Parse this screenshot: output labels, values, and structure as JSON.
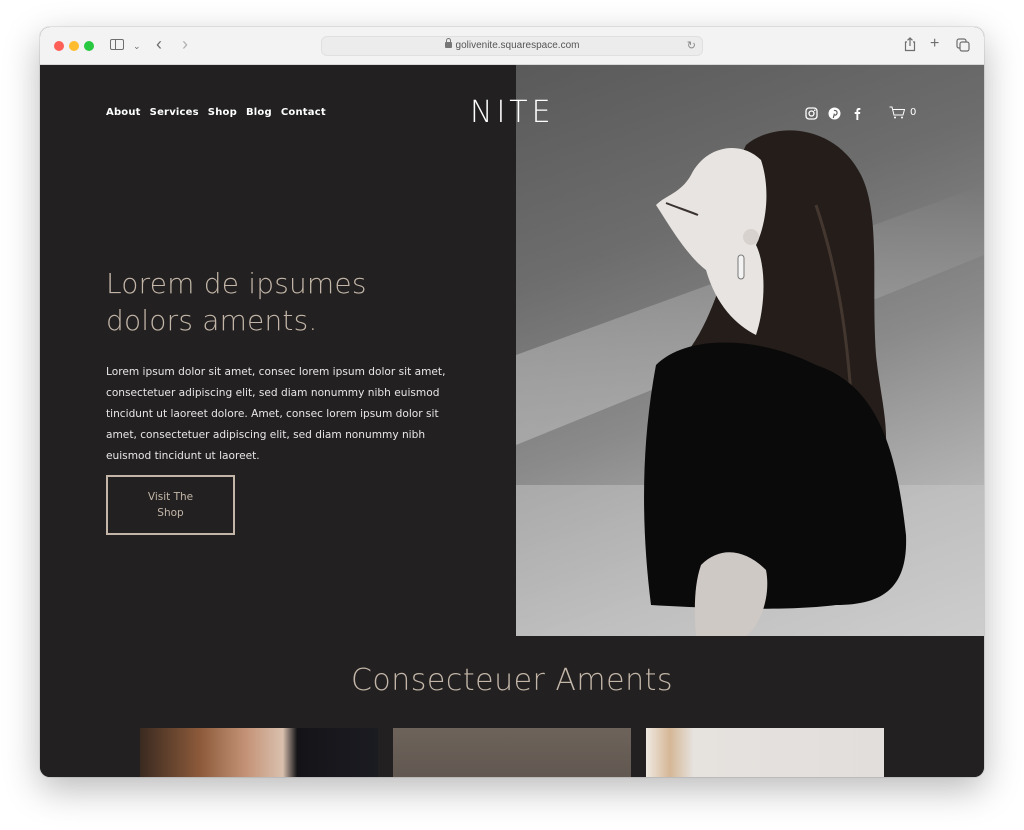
{
  "browser": {
    "url": "golivenite.squarespace.com",
    "buttons": {
      "sidebar": "sidebar-icon",
      "back": "‹",
      "forward": "›",
      "share": "share-icon",
      "new_tab": "+",
      "tabs": "tabs-icon",
      "reload": "↻"
    }
  },
  "site": {
    "logo": "NITE",
    "nav": [
      {
        "label": "About"
      },
      {
        "label": "Services"
      },
      {
        "label": "Shop"
      },
      {
        "label": "Blog"
      },
      {
        "label": "Contact"
      }
    ],
    "socials": [
      "instagram",
      "pinterest",
      "facebook"
    ],
    "cart_count": "0",
    "colors": {
      "background": "#222021",
      "accent": "#c3b6a8",
      "text": "#ffffff"
    }
  },
  "hero": {
    "headline_line1": "Lorem de ipsumes",
    "headline_line2": "dolors aments.",
    "body": "Lorem ipsum dolor sit amet, consec lorem ipsum dolor sit amet, consectetuer adipiscing elit, sed diam nonummy nibh euismod tincidunt ut laoreet dolore. Amet, consec lorem ipsum dolor sit amet, consectetuer adipiscing elit, sed diam nonummy nibh euismod tincidunt ut laoreet.",
    "cta_label": "Visit The Shop",
    "image_alt": "Black and white portrait of a woman looking upward"
  },
  "section": {
    "title": "Consecteuer Aments",
    "cards": [
      {
        "image_alt": "Woman with hands clasped"
      },
      {
        "image_alt": "Muted brown photo"
      },
      {
        "image_alt": "Light neutral photo"
      }
    ]
  }
}
